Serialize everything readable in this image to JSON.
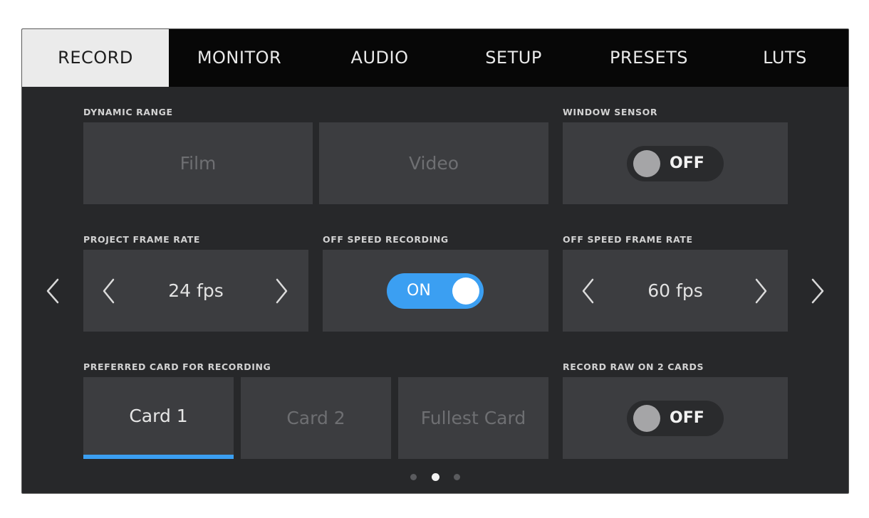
{
  "tabs": [
    {
      "label": "RECORD",
      "active": true
    },
    {
      "label": "MONITOR",
      "active": false
    },
    {
      "label": "AUDIO",
      "active": false
    },
    {
      "label": "SETUP",
      "active": false
    },
    {
      "label": "PRESETS",
      "active": false
    },
    {
      "label": "LUTS",
      "active": false
    }
  ],
  "dynamic_range": {
    "label": "DYNAMIC RANGE",
    "options": [
      "Film",
      "Video"
    ],
    "selected": "none"
  },
  "window_sensor": {
    "label": "WINDOW SENSOR",
    "state": "OFF"
  },
  "project_frame_rate": {
    "label": "PROJECT FRAME RATE",
    "value": "24 fps"
  },
  "off_speed_recording": {
    "label": "OFF SPEED RECORDING",
    "state": "ON"
  },
  "off_speed_frame_rate": {
    "label": "OFF SPEED FRAME RATE",
    "value": "60 fps"
  },
  "preferred_card": {
    "label": "PREFERRED CARD FOR RECORDING",
    "options": [
      "Card 1",
      "Card 2",
      "Fullest Card"
    ],
    "selected": "Card 1"
  },
  "record_raw_two_cards": {
    "label": "RECORD RAW ON 2 CARDS",
    "state": "OFF"
  },
  "pagination": {
    "total": 3,
    "current": 2
  },
  "colors": {
    "accent": "#3b9ff2",
    "panel": "#3c3d40",
    "background": "#27282a",
    "tabbar": "#070707"
  },
  "icons": {
    "page_prev": "chevron-left-icon",
    "page_next": "chevron-right-icon",
    "stepper_dec": "chevron-left-icon",
    "stepper_inc": "chevron-right-icon"
  }
}
